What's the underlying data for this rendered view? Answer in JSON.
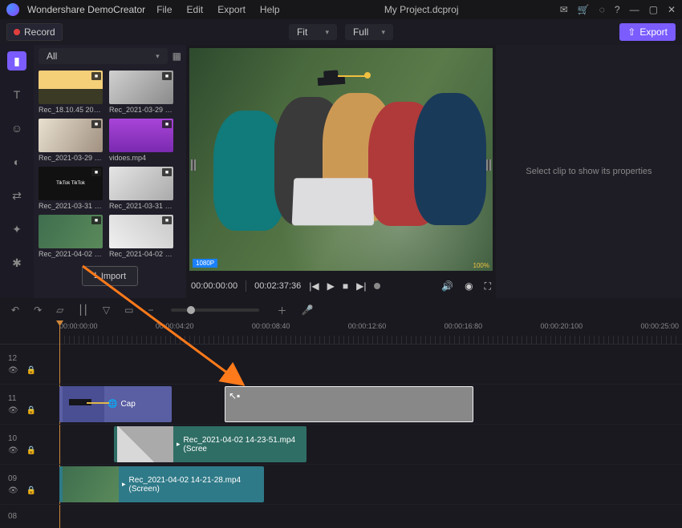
{
  "app": {
    "name": "Wondershare DemoCreator"
  },
  "menu": {
    "file": "File",
    "edit": "Edit",
    "export": "Export",
    "help": "Help"
  },
  "project": {
    "title": "My Project.dcproj"
  },
  "window": {
    "minimize": "—",
    "restore": "▢",
    "close": "✕"
  },
  "toolbar": {
    "record": "Record",
    "fit": "Fit",
    "full": "Full",
    "export": "Export"
  },
  "media": {
    "filter": "All",
    "import": "Import",
    "clips": [
      {
        "name": "Rec_18.10.45 2021..."
      },
      {
        "name": "Rec_2021-03-29 09..."
      },
      {
        "name": "Rec_2021-03-29 09..."
      },
      {
        "name": "vidoes.mp4"
      },
      {
        "name": "Rec_2021-03-31 14..."
      },
      {
        "name": "Rec_2021-03-31 16..."
      },
      {
        "name": "Rec_2021-04-02 14..."
      },
      {
        "name": "Rec_2021-04-02 14..."
      }
    ]
  },
  "preview": {
    "badge_res": "1080P",
    "badge_pct": "100%",
    "time_current": "00:00:00:00",
    "time_total": "00:02:37:36"
  },
  "props": {
    "empty": "Select clip to show its properties"
  },
  "ruler": {
    "marks": [
      "00:00:00:00",
      "00:00:04:20",
      "00:00:08:40",
      "00:00:12:60",
      "00:00:16:80",
      "00:00:20:100",
      "00:00:25:00"
    ]
  },
  "tracks": {
    "t12": "12",
    "t11": "11",
    "t10": "10",
    "t09": "09",
    "t08": "08",
    "cap_label": "Cap",
    "clip2_label": "Rec_2021-04-02 14-23-51.mp4 (Scree",
    "clip3_label": "Rec_2021-04-02 14-21-28.mp4 (Screen)"
  }
}
